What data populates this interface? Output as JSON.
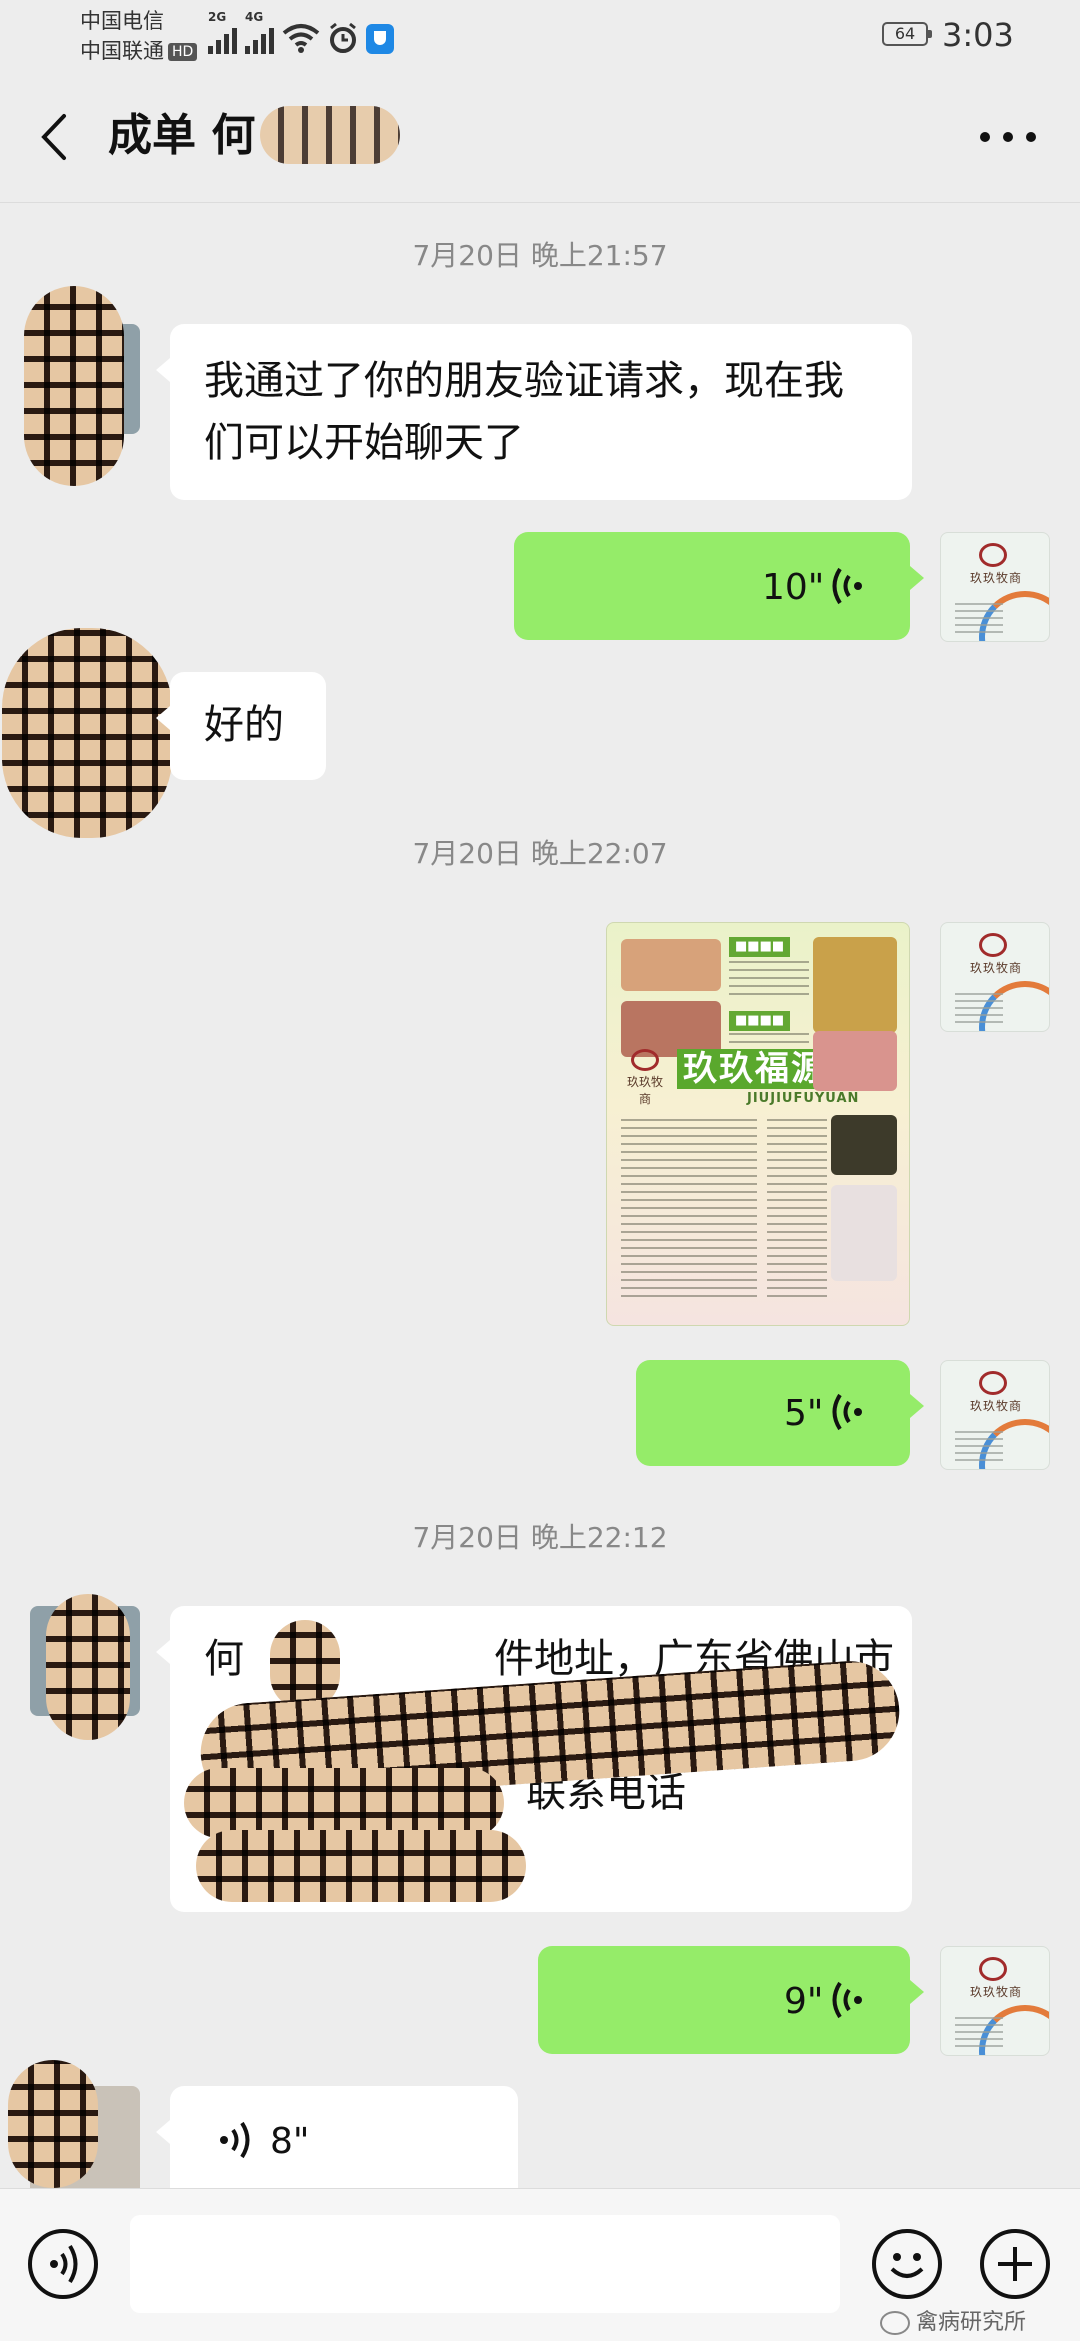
{
  "status_bar": {
    "carrier_1": "中国电信",
    "carrier_2": "中国联通",
    "hd_label": "HD",
    "net_1": "2G",
    "net_2": "4G",
    "battery": "64",
    "time": "3:03"
  },
  "header": {
    "title": "成单 何",
    "back_icon": "chevron-left-icon",
    "more_icon": "ellipsis-icon"
  },
  "messages": {
    "ts1": "7月20日 晚上21:57",
    "m1_text": "我通过了你的朋友验证请求，现在我们可以开始聊天了",
    "m2_duration": "10\"",
    "m3_text": "好的",
    "ts2": "7月20日 晚上22:07",
    "poster": {
      "title": "玖玖福源",
      "subtitle": "JIUJIUFUYUAN",
      "brand": "玖玖牧商"
    },
    "m5_duration": "5\"",
    "ts3": "7月20日 晚上22:12",
    "m6_line1": "何",
    "m6_line1_b": "件地址，广东省佛山市",
    "m6_line3": "联系电话",
    "m7_duration": "9\"",
    "m8_duration": "8\""
  },
  "avatars": {
    "mine_brand": "玖玖牧商"
  },
  "input_bar": {
    "voice_icon": "voice-icon",
    "emoji_icon": "emoji-icon",
    "plus_icon": "plus-icon"
  },
  "watermark": "禽病研究所",
  "colors": {
    "background": "#ededed",
    "bubble_right": "#95ec69",
    "bubble_left": "#ffffff"
  }
}
